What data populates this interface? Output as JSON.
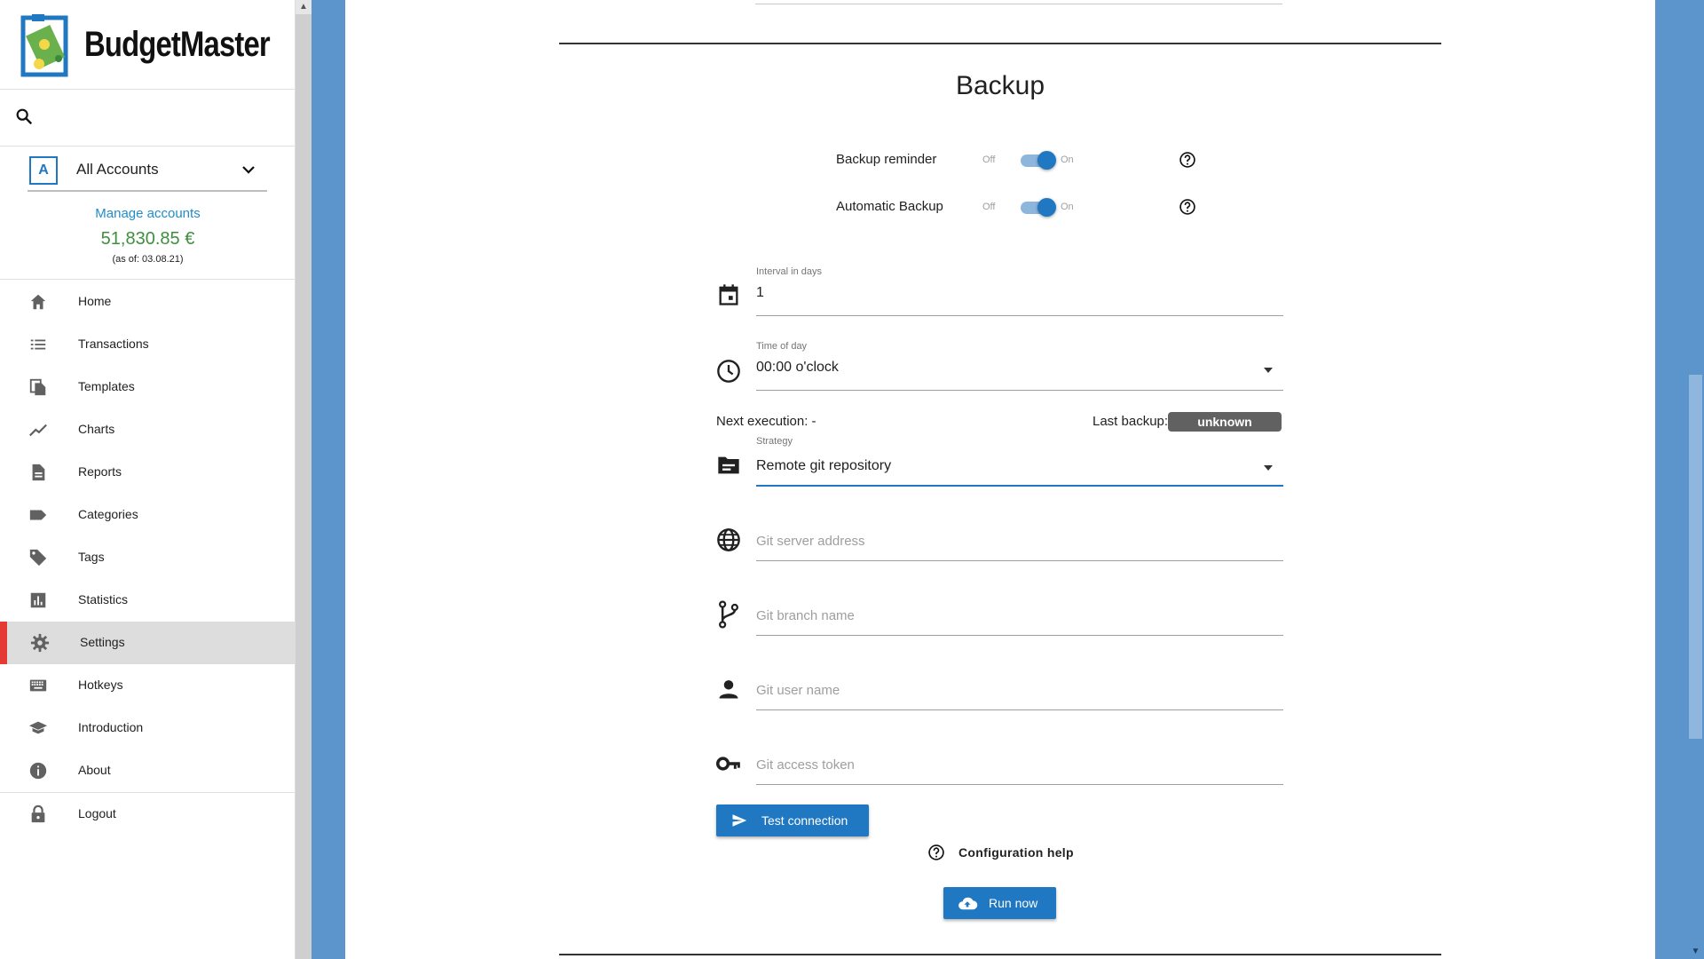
{
  "app": {
    "name": "BudgetMaster"
  },
  "sidebar": {
    "account_selector": {
      "badge": "A",
      "label": "All Accounts"
    },
    "manage_accounts": "Manage accounts",
    "balance": "51,830.85 €",
    "as_of": "(as of: 03.08.21)",
    "items": [
      {
        "label": "Home",
        "icon": "home-icon"
      },
      {
        "label": "Transactions",
        "icon": "list-icon"
      },
      {
        "label": "Templates",
        "icon": "file-copy-icon"
      },
      {
        "label": "Charts",
        "icon": "trending-up-icon"
      },
      {
        "label": "Reports",
        "icon": "description-icon"
      },
      {
        "label": "Categories",
        "icon": "label-icon"
      },
      {
        "label": "Tags",
        "icon": "tag-icon"
      },
      {
        "label": "Statistics",
        "icon": "bar-chart-icon"
      },
      {
        "label": "Settings",
        "icon": "gear-icon",
        "active": true
      },
      {
        "label": "Hotkeys",
        "icon": "keyboard-icon"
      },
      {
        "label": "Introduction",
        "icon": "school-icon"
      },
      {
        "label": "About",
        "icon": "info-icon"
      },
      {
        "label": "Logout",
        "icon": "lock-icon"
      }
    ]
  },
  "main": {
    "section_title": "Backup",
    "backup_reminder": {
      "label": "Backup reminder",
      "off": "Off",
      "on": "On",
      "enabled": true
    },
    "automatic_backup": {
      "label": "Automatic Backup",
      "off": "Off",
      "on": "On",
      "enabled": true
    },
    "interval": {
      "label": "Interval in days",
      "value": "1"
    },
    "time_of_day": {
      "label": "Time of day",
      "value": "00:00 o'clock"
    },
    "next_execution": "Next execution: -",
    "last_backup_label": "Last backup:",
    "last_backup_value": "unknown",
    "strategy": {
      "label": "Strategy",
      "value": "Remote git repository"
    },
    "git_server": {
      "placeholder": "Git server address"
    },
    "git_branch": {
      "placeholder": "Git branch name"
    },
    "git_user": {
      "placeholder": "Git user name"
    },
    "git_token": {
      "placeholder": "Git access token"
    },
    "test_connection": "Test connection",
    "configuration_help": "Configuration help",
    "run_now": "Run now"
  },
  "colors": {
    "accent": "#1f78c1",
    "balance_green": "#3f8f3f",
    "active_marker": "#e53935",
    "page_bg_blue": "#5b95cb"
  }
}
